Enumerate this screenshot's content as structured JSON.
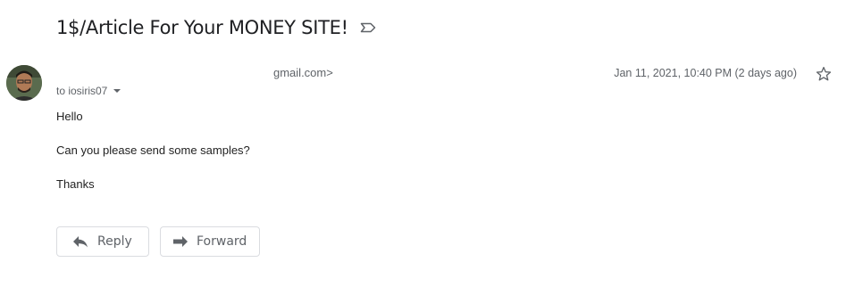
{
  "message": {
    "subject": "1$/Article For Your MONEY SITE!",
    "sender_visible": "gmail.com>",
    "recipient": "to iosiris07",
    "date": "Jan 11, 2021, 10:40 PM (2 days ago)",
    "body": [
      "Hello",
      "Can you please send some samples?",
      "Thanks"
    ]
  },
  "actions": {
    "reply_label": "Reply",
    "forward_label": "Forward"
  },
  "icons": {
    "label": "label-outline-icon",
    "star": "star-outline-icon",
    "reply": "reply-arrow-icon",
    "forward": "forward-arrow-icon",
    "recipient_details": "caret-down-icon"
  },
  "colors": {
    "text_primary": "#222222",
    "text_secondary": "#5f6368",
    "button_border": "#dadce0"
  }
}
